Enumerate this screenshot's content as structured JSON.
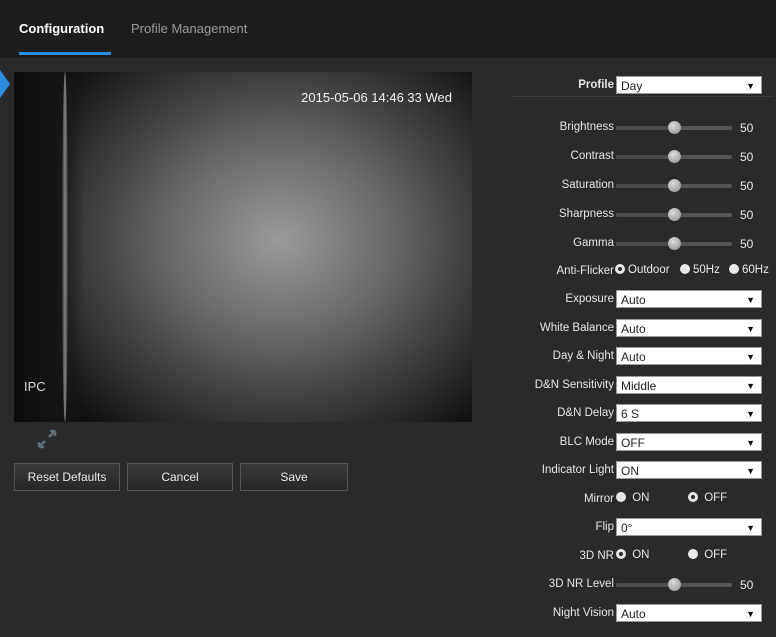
{
  "tabs": [
    {
      "label": "Configuration",
      "active": true
    },
    {
      "label": "Profile Management",
      "active": false
    }
  ],
  "video": {
    "timestamp": "2015-05-06 14:46 33 Wed",
    "channel_name": "IPC",
    "expand_icon": "expand-icon"
  },
  "buttons": {
    "reset": "Reset Defaults",
    "cancel": "Cancel",
    "save": "Save"
  },
  "settings": {
    "profile": {
      "label": "Profile",
      "value": "Day"
    },
    "brightness": {
      "label": "Brightness",
      "value": "50",
      "level": 50
    },
    "contrast": {
      "label": "Contrast",
      "value": "50",
      "level": 50
    },
    "saturation": {
      "label": "Saturation",
      "value": "50",
      "level": 50
    },
    "sharpness": {
      "label": "Sharpness",
      "value": "50",
      "level": 50
    },
    "gamma": {
      "label": "Gamma",
      "value": "50",
      "level": 50
    },
    "anti_flicker": {
      "label": "Anti-Flicker",
      "options": [
        "Outdoor",
        "50Hz",
        "60Hz"
      ],
      "selected": "Outdoor"
    },
    "exposure": {
      "label": "Exposure",
      "value": "Auto"
    },
    "white_balance": {
      "label": "White Balance",
      "value": "Auto"
    },
    "day_night": {
      "label": "Day & Night",
      "value": "Auto"
    },
    "dn_sensitivity": {
      "label": "D&N Sensitivity",
      "value": "Middle"
    },
    "dn_delay": {
      "label": "D&N Delay",
      "value": "6 S"
    },
    "blc_mode": {
      "label": "BLC Mode",
      "value": "OFF"
    },
    "indicator_light": {
      "label": "Indicator Light",
      "value": "ON"
    },
    "mirror": {
      "label": "Mirror",
      "on": "ON",
      "off": "OFF",
      "selected": "OFF"
    },
    "flip": {
      "label": "Flip",
      "value": "0°"
    },
    "nr3d": {
      "label": "3D NR",
      "on": "ON",
      "off": "OFF",
      "selected": "ON"
    },
    "nr3d_level": {
      "label": "3D NR Level",
      "value": "50",
      "level": 50
    },
    "night_vision": {
      "label": "Night Vision",
      "value": "Auto"
    }
  },
  "colors": {
    "accent": "#2b8de0",
    "panel": "#2a2a2a",
    "background": "#1d1d1d"
  }
}
